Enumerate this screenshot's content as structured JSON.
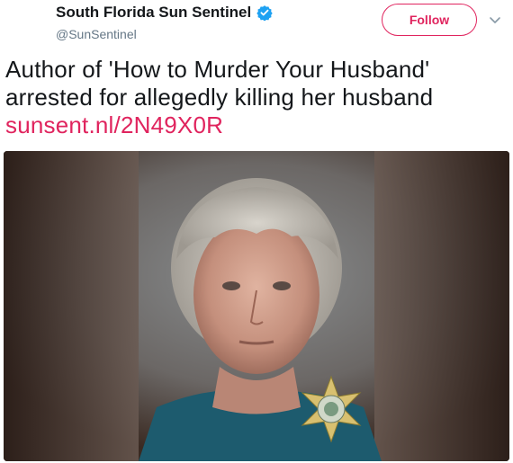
{
  "tweet": {
    "display_name": "South Florida Sun Sentinel",
    "handle": "@SunSentinel",
    "follow_label": "Follow",
    "text_line1": "Author of 'How to Murder Your Husband'",
    "text_line2": "arrested for allegedly killing her husband",
    "link": "sunsent.nl/2N49X0R",
    "accent_color": "#e0245e",
    "verified_color": "#1da1f2"
  },
  "icons": {
    "verified": "verified-badge-icon",
    "menu": "chevron-down-icon",
    "badge": "sheriff-star-badge"
  }
}
